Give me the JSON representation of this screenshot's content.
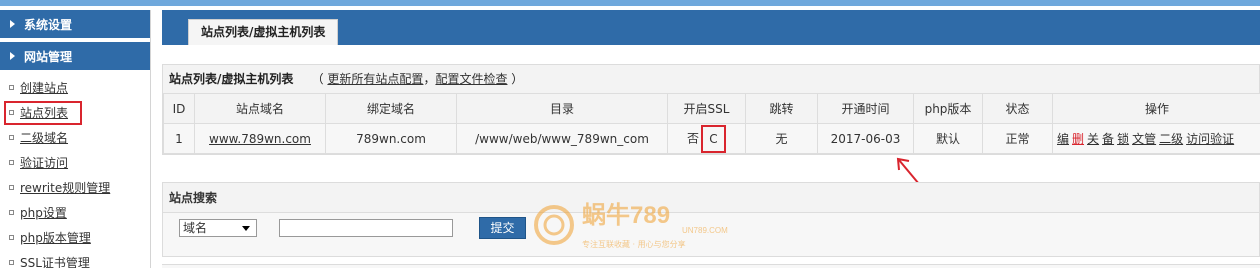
{
  "sidebar": {
    "sections": [
      {
        "label": "系统设置"
      },
      {
        "label": "网站管理"
      }
    ],
    "items": [
      {
        "label": "创建站点"
      },
      {
        "label": "站点列表"
      },
      {
        "label": "二级域名"
      },
      {
        "label": "验证访问"
      },
      {
        "label": "rewrite规则管理"
      },
      {
        "label": "php设置"
      },
      {
        "label": "php版本管理"
      },
      {
        "label": "SSL证书管理"
      }
    ],
    "active_item": "站点列表"
  },
  "tab": {
    "label": "站点列表/虚拟主机列表"
  },
  "list_panel": {
    "title": "站点列表/虚拟主机列表",
    "paren_open": "（",
    "link_update": "更新所有站点配置",
    "sep": "，",
    "link_check": "配置文件检查",
    "paren_close": "）"
  },
  "table": {
    "headers": [
      "ID",
      "站点域名",
      "绑定域名",
      "目录",
      "开启SSL",
      "跳转",
      "开通时间",
      "php版本",
      "状态",
      "操作"
    ],
    "rows": [
      {
        "id": "1",
        "domain": "www.789wn.com",
        "bind": "789wn.com",
        "dir": "/www/web/www_789wn_com",
        "ssl_no": "否",
        "ssl_c": "C",
        "redirect": "无",
        "date": "2017-06-03",
        "php": "默认",
        "status": "正常",
        "ops": [
          "编",
          "删",
          "关",
          "备",
          "锁",
          "文管",
          "二级",
          "访问验证"
        ]
      }
    ]
  },
  "search": {
    "title": "站点搜索",
    "select_value": "域名",
    "input_value": "",
    "submit_label": "提交"
  },
  "watermark": {
    "text": "蜗牛789",
    "sub": "UN789.COM",
    "tagline": "专注互联收藏 · 用心与您分享"
  },
  "colors": {
    "nav_blue": "#2f6ba8",
    "highlight_red": "#d9252e",
    "watermark_orange": "#f0a030"
  }
}
